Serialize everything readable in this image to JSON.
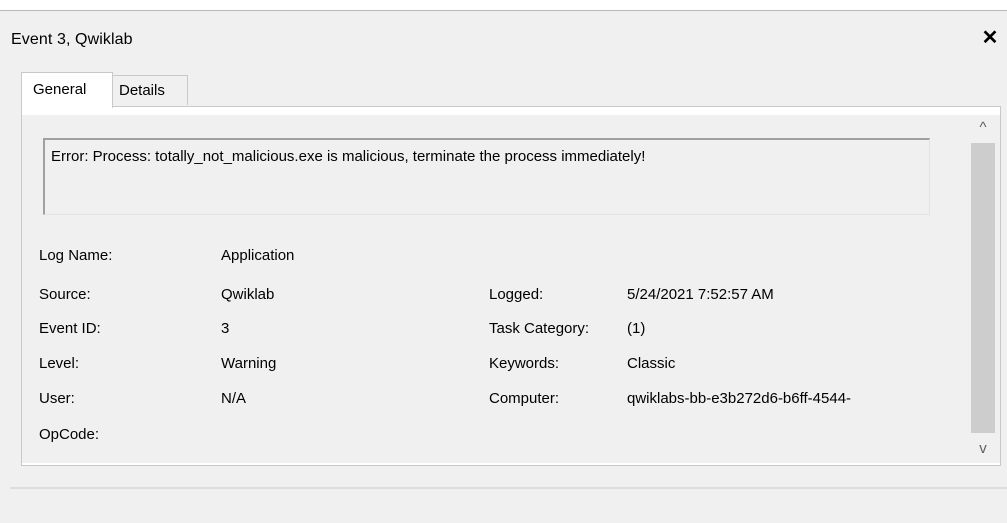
{
  "window": {
    "title": "Event 3, Qwiklab",
    "close_glyph": "✕"
  },
  "tabs": [
    {
      "label": "General",
      "selected": true
    },
    {
      "label": "Details",
      "selected": false
    }
  ],
  "description": "Error: Process: totally_not_malicious.exe is malicious, terminate the process immediately!",
  "fields_left": [
    {
      "label": "Log Name:",
      "value": "Application"
    },
    {
      "label": "Source:",
      "value": "Qwiklab"
    },
    {
      "label": "Event ID:",
      "value": "3"
    },
    {
      "label": "Level:",
      "value": "Warning"
    },
    {
      "label": "User:",
      "value": "N/A"
    },
    {
      "label": "OpCode:",
      "value": ""
    }
  ],
  "fields_right": [
    {
      "label": "Logged:",
      "value": "5/24/2021 7:52:57 AM"
    },
    {
      "label": "Task Category:",
      "value": "(1)"
    },
    {
      "label": "Keywords:",
      "value": "Classic"
    },
    {
      "label": "Computer:",
      "value": "qwiklabs-bb-e3b272d6-b6ff-4544-"
    }
  ],
  "scrollbar": {
    "up_glyph": "^",
    "down_glyph": "v"
  }
}
